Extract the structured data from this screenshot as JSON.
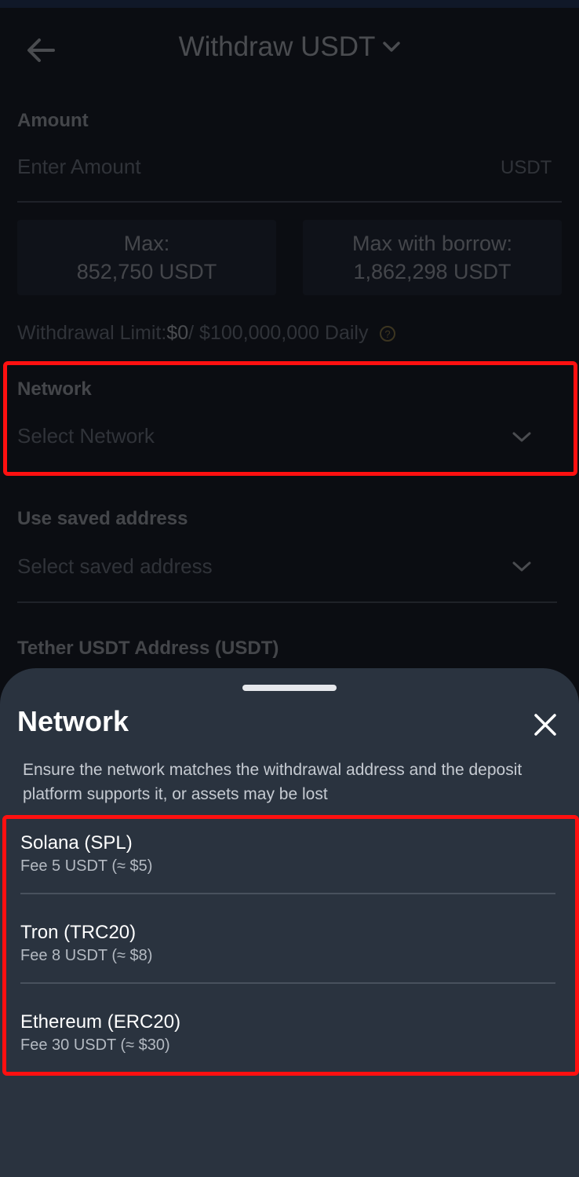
{
  "header": {
    "title": "Withdraw USDT",
    "back_icon": "arrow-left-icon",
    "dropdown_icon": "chevron-down-icon"
  },
  "amount": {
    "label": "Amount",
    "placeholder": "Enter Amount",
    "unit": "USDT"
  },
  "max": {
    "label": "Max:",
    "value": "852,750 USDT"
  },
  "max_borrow": {
    "label": "Max with borrow:",
    "value": "1,862,298 USDT"
  },
  "limit": {
    "prefix": "Withdrawal Limit:",
    "value": "$0",
    "suffix": " / $100,000,000 Daily"
  },
  "network_field": {
    "label": "Network",
    "placeholder": "Select Network"
  },
  "saved_address": {
    "label": "Use saved address",
    "placeholder": "Select saved address"
  },
  "address": {
    "label": "Tether USDT Address (USDT)"
  },
  "sheet": {
    "title": "Network",
    "note": "Ensure the network matches the withdrawal address and the deposit platform supports it, or assets may be lost",
    "options": [
      {
        "name": "Solana (SPL)",
        "fee": "Fee 5 USDT (≈ $5)"
      },
      {
        "name": "Tron (TRC20)",
        "fee": "Fee 8 USDT (≈ $8)"
      },
      {
        "name": "Ethereum (ERC20)",
        "fee": "Fee 30 USDT (≈ $30)"
      }
    ]
  },
  "colors": {
    "highlight": "#ff1010",
    "sheet_bg": "#2a333f",
    "page_bg": "#0b0d12"
  }
}
